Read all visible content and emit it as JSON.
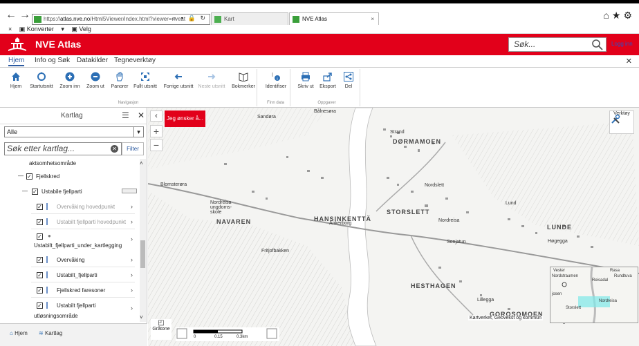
{
  "browser": {
    "url_prefix": "https://",
    "url_host": "atlas.nve.no",
    "url_path": "/Html5Viewer/index.html?viewer=nveat",
    "address_controls": "⌕ ▾ 🔒 ↻",
    "tabs": [
      {
        "label": "Kart"
      },
      {
        "label": "NVE Atlas"
      }
    ],
    "toolbar": [
      "Konverter",
      "Velg"
    ]
  },
  "app": {
    "title": "NVE Atlas",
    "search_placeholder": "Søk...",
    "login": "Logg inn"
  },
  "ribbon": {
    "tabs": [
      "Hjem",
      "Info og Søk",
      "Datakilder",
      "Tegneverktøy"
    ],
    "groups": [
      {
        "label": "Navigasjon"
      },
      {
        "label": "Finn data"
      },
      {
        "label": "Oppgaver"
      }
    ],
    "buttons": [
      {
        "label": "Hjem",
        "icon": "home-icon"
      },
      {
        "label": "Startutsnitt",
        "icon": "initial-extent-icon"
      },
      {
        "label": "Zoom inn",
        "icon": "zoom-in-icon"
      },
      {
        "label": "Zoom ut",
        "icon": "zoom-out-icon"
      },
      {
        "label": "Panorer",
        "icon": "hand-icon"
      },
      {
        "label": "Fullt utsnitt",
        "icon": "full-extent-icon"
      },
      {
        "label": "Forrige utsnitt",
        "icon": "arrow-left-icon"
      },
      {
        "label": "Neste utsnitt",
        "icon": "arrow-right-icon"
      },
      {
        "label": "Bokmerker",
        "icon": "book-icon"
      },
      {
        "label": "Identifiser",
        "icon": "identify-icon"
      },
      {
        "label": "Skriv ut",
        "icon": "print-icon"
      },
      {
        "label": "Eksport",
        "icon": "export-icon"
      },
      {
        "label": "Del",
        "icon": "share-icon"
      }
    ]
  },
  "layers_panel": {
    "title": "Kartlag",
    "filter_value": "Alle",
    "search_placeholder": "Søk etter kartlag...",
    "filter_button": "Filter",
    "rows": [
      {
        "label": "aktsomhetsområde"
      },
      {
        "label": "Fjellskred"
      },
      {
        "label": "Ustabile fjellparti"
      },
      {
        "label": "Overvåking hovedpunkt"
      },
      {
        "label": "Ustabilt fjellparti hovedpunkt"
      },
      {
        "label": "Ustabilt_fjellparti_under_kartlegging"
      },
      {
        "label": "Overvåking"
      },
      {
        "label": "Ustabilt_fjellparti"
      },
      {
        "label": "Fjellskred faresoner"
      },
      {
        "label": "Ustabilt fjellparti"
      },
      {
        "label": "utløsningsområde"
      }
    ]
  },
  "bottom_bar": {
    "items": [
      {
        "label": "Hjem"
      },
      {
        "label": "Kartlag"
      }
    ]
  },
  "map": {
    "wish_button": "Jeg ønsker å...",
    "tools_button": "Verktøy",
    "graytone": "Gråtone",
    "attribution": "Kartverket, Geovekst og kommun",
    "scale_labels": [
      "0",
      "0.15",
      "0.3km"
    ],
    "labels": [
      "Bålnesøra",
      "Sandøra",
      "Strand",
      "DØRMAMOEN",
      "Nordslett",
      "Blomsterøra",
      "Nordreisa ungdoms-skole",
      "NAVAREN",
      "HANSINKENTTÄ",
      "STORSLETT",
      "Nordreisa",
      "Lund",
      "LUNDE",
      "Høgegga",
      "Sonjatun",
      "Fritjofbakken",
      "HESTHAGEN",
      "Lillegga",
      "GOROSOMOEN",
      "Ankerborg",
      "Rasa",
      "Rundtuva",
      "Reisadal",
      "Vester",
      "Nordstraumen",
      "Storslett",
      "josen",
      "Nordreisa"
    ]
  }
}
